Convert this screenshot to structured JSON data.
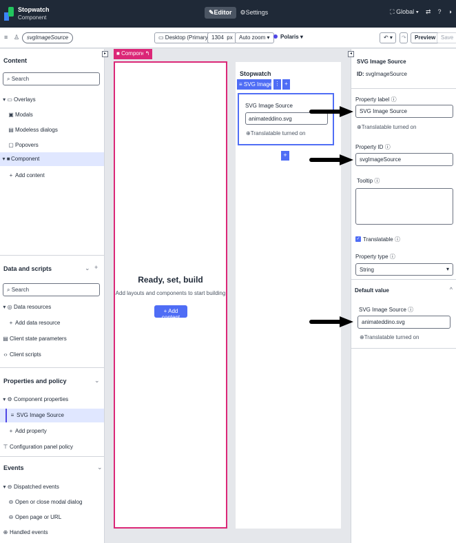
{
  "app": {
    "name": "Stopwatch",
    "subtitle": "Component",
    "tab_editor": "Editor",
    "tab_settings": "Settings",
    "scope": "Global"
  },
  "toolbar": {
    "component_pill": "svgImageSource",
    "device": "Desktop (Primary)*",
    "width_value": "1304",
    "width_unit": "px",
    "zoom": "Auto zoom",
    "theme": "Polaris",
    "preview": "Preview",
    "save": "Save"
  },
  "left": {
    "content_title": "Content",
    "search_placeholder": "Search",
    "items": [
      {
        "label": "Overlays",
        "marker": "▾ ▭"
      },
      {
        "label": "Modals",
        "marker": "▣"
      },
      {
        "label": "Modeless dialogs",
        "marker": "▤"
      },
      {
        "label": "Popovers",
        "marker": "▢"
      },
      {
        "label": "Component",
        "marker": "▾ ■"
      },
      {
        "label": "Add content",
        "marker": "+"
      }
    ],
    "data_title": "Data and scripts",
    "data_search_placeholder": "Search",
    "data_items": [
      {
        "label": "Data resources",
        "marker": "▾ ◎"
      },
      {
        "label": "Add data resource",
        "marker": "+"
      },
      {
        "label": "Client state parameters",
        "marker": "▤"
      },
      {
        "label": "Client scripts",
        "marker": "‹›"
      }
    ],
    "props_title": "Properties and policy",
    "props_items": [
      {
        "label": "Component properties",
        "marker": "▾ ⚙"
      },
      {
        "label": "SVG Image Source",
        "marker": "≡"
      },
      {
        "label": "Add property",
        "marker": "+"
      },
      {
        "label": "Configuration panel policy",
        "marker": "⊤"
      }
    ],
    "events_title": "Events",
    "events_items": [
      {
        "label": "Dispatched events",
        "marker": "▾ ⊖"
      },
      {
        "label": "Open or close modal dialog",
        "marker": "⊖"
      },
      {
        "label": "Open page or URL",
        "marker": "⊖"
      },
      {
        "label": "Handled events",
        "marker": "⊕"
      }
    ]
  },
  "canvas": {
    "component_tag": "Component",
    "ready_title": "Ready, set, build",
    "ready_sub": "Add layouts and components to start building",
    "add_content": "+ Add content"
  },
  "mini": {
    "title": "Stopwatch",
    "chip": "SVG Image S...",
    "field_label": "SVG Image Source",
    "field_value": "animateddino.svg",
    "translatable": "Translatable turned on"
  },
  "right": {
    "title": "SVG Image Source",
    "id_label": "ID:",
    "id_value": "svgImageSource",
    "property_label_label": "Property label",
    "property_label_value": "SVG Image Source",
    "translatable_note": "Translatable turned on",
    "property_id_label": "Property ID",
    "property_id_value": "svgImageSource",
    "tooltip_label": "Tooltip",
    "translatable_check": "Translatable",
    "property_type_label": "Property type",
    "property_type_value": "String",
    "default_value_title": "Default value",
    "default_field_label": "SVG Image Source",
    "default_field_value": "animateddino.svg",
    "default_translatable_note": "Translatable turned on"
  },
  "colors": {
    "topbar": "#1f2937",
    "accent": "#4f6df5",
    "component_pink": "#db2777",
    "selection": "#e0e7ff"
  }
}
